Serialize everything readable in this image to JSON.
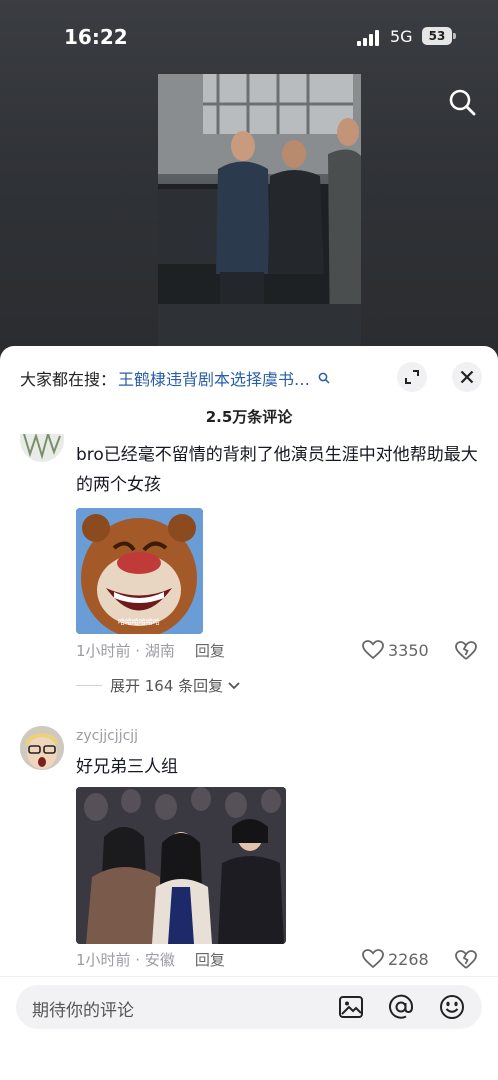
{
  "status": {
    "time": "16:22",
    "network": "5G",
    "battery": "53"
  },
  "panel": {
    "hot_search_prefix": "大家都在搜：",
    "hot_search_term": "王鹤棣违背剧本选择虞书…",
    "comment_count": "2.5万条评论"
  },
  "comments": [
    {
      "text": "bro已经毫不留情的背刺了他演员生涯中对他帮助最大的两个女孩",
      "image_caption": "哈哈哈哈哈哈",
      "time_location": "1小时前 · 湖南",
      "reply": "回复",
      "likes": "3350",
      "expand_replies": "展开 164 条回复"
    },
    {
      "username": "zycjjcjjcjj",
      "text": "好兄弟三人组",
      "time_location": "1小时前 · 安徽",
      "reply": "回复",
      "likes": "2268"
    }
  ],
  "input": {
    "placeholder": "期待你的评论"
  },
  "icons": {
    "search": "search-icon",
    "expand": "expand-icon",
    "close": "close-icon",
    "like": "heart-icon",
    "dislike": "broken-heart-icon",
    "image": "image-icon",
    "mention": "at-icon",
    "emoji": "emoji-icon"
  }
}
